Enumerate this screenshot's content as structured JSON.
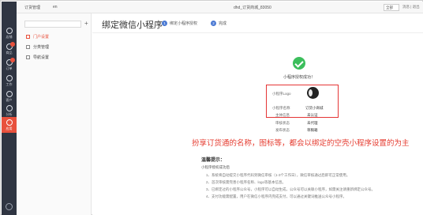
{
  "header": {
    "app_title": "订货管理",
    "tab_selector": "en",
    "store_name": "dhd_订货商城_83050",
    "user_menu": "全部",
    "links": "消息  |  退出"
  },
  "rail": {
    "items": [
      {
        "label": "店铺",
        "icon": "chat-icon"
      },
      {
        "label": "商品",
        "icon": "cart-icon",
        "badge": ""
      },
      {
        "label": "订单",
        "icon": "order-icon",
        "badge": ""
      },
      {
        "label": "工作",
        "icon": "work-icon"
      },
      {
        "label": "客户",
        "icon": "customer-icon"
      },
      {
        "label": "分析",
        "icon": "chart-icon"
      },
      {
        "label": "应用",
        "icon": "app-icon"
      }
    ],
    "settings_icon": "gear-icon"
  },
  "subnav": {
    "items": [
      {
        "label": "门户设置",
        "active": true
      },
      {
        "label": "分类管理",
        "active": false
      },
      {
        "label": "导航设置",
        "active": false
      }
    ]
  },
  "page": {
    "title": "绑定微信小程序",
    "steps": [
      {
        "num": "1",
        "label": "绑定小程序授权"
      },
      {
        "num": "2",
        "label": "完成"
      }
    ],
    "success_text": "小程序授权成功！",
    "info": {
      "logo_label": "小程序Logo",
      "name_label": "小程序名称",
      "name_value": "订货小商城",
      "subject_label": "主体信息",
      "subject_value": "未认证",
      "review_label": "审核状态",
      "review_value": "未代理",
      "publish_label": "发布状态",
      "publish_value": "草稿箱"
    },
    "annotation": "扮享订货通的名称，图标等，都会以绑定的空壳小程序设置的为主",
    "notes": {
      "title": "温馨提示：",
      "subtitle": "小程序授权成功后",
      "items": [
        "1、系统将自动提交小程序代码到微信审核（1-3个工作日），微信审核通过后即可正常使用。",
        "2、首次审核需完善小程序名称、logo等基本信息。",
        "3、已绑定过的小程序公众号，小程序可以自动生成，公众号可以关联小程序，如需关注请重新绑定公众号。",
        "4、支付功能需配置，用户在微信小程序内完成支付，可以通过关键词推送公众号小程序。"
      ]
    }
  },
  "colors": {
    "rail_bg": "#2f3542",
    "accent": "#e8513d",
    "success": "#3cbe5c",
    "annotation": "#e53b2f",
    "step_active": "#4a79d3"
  }
}
